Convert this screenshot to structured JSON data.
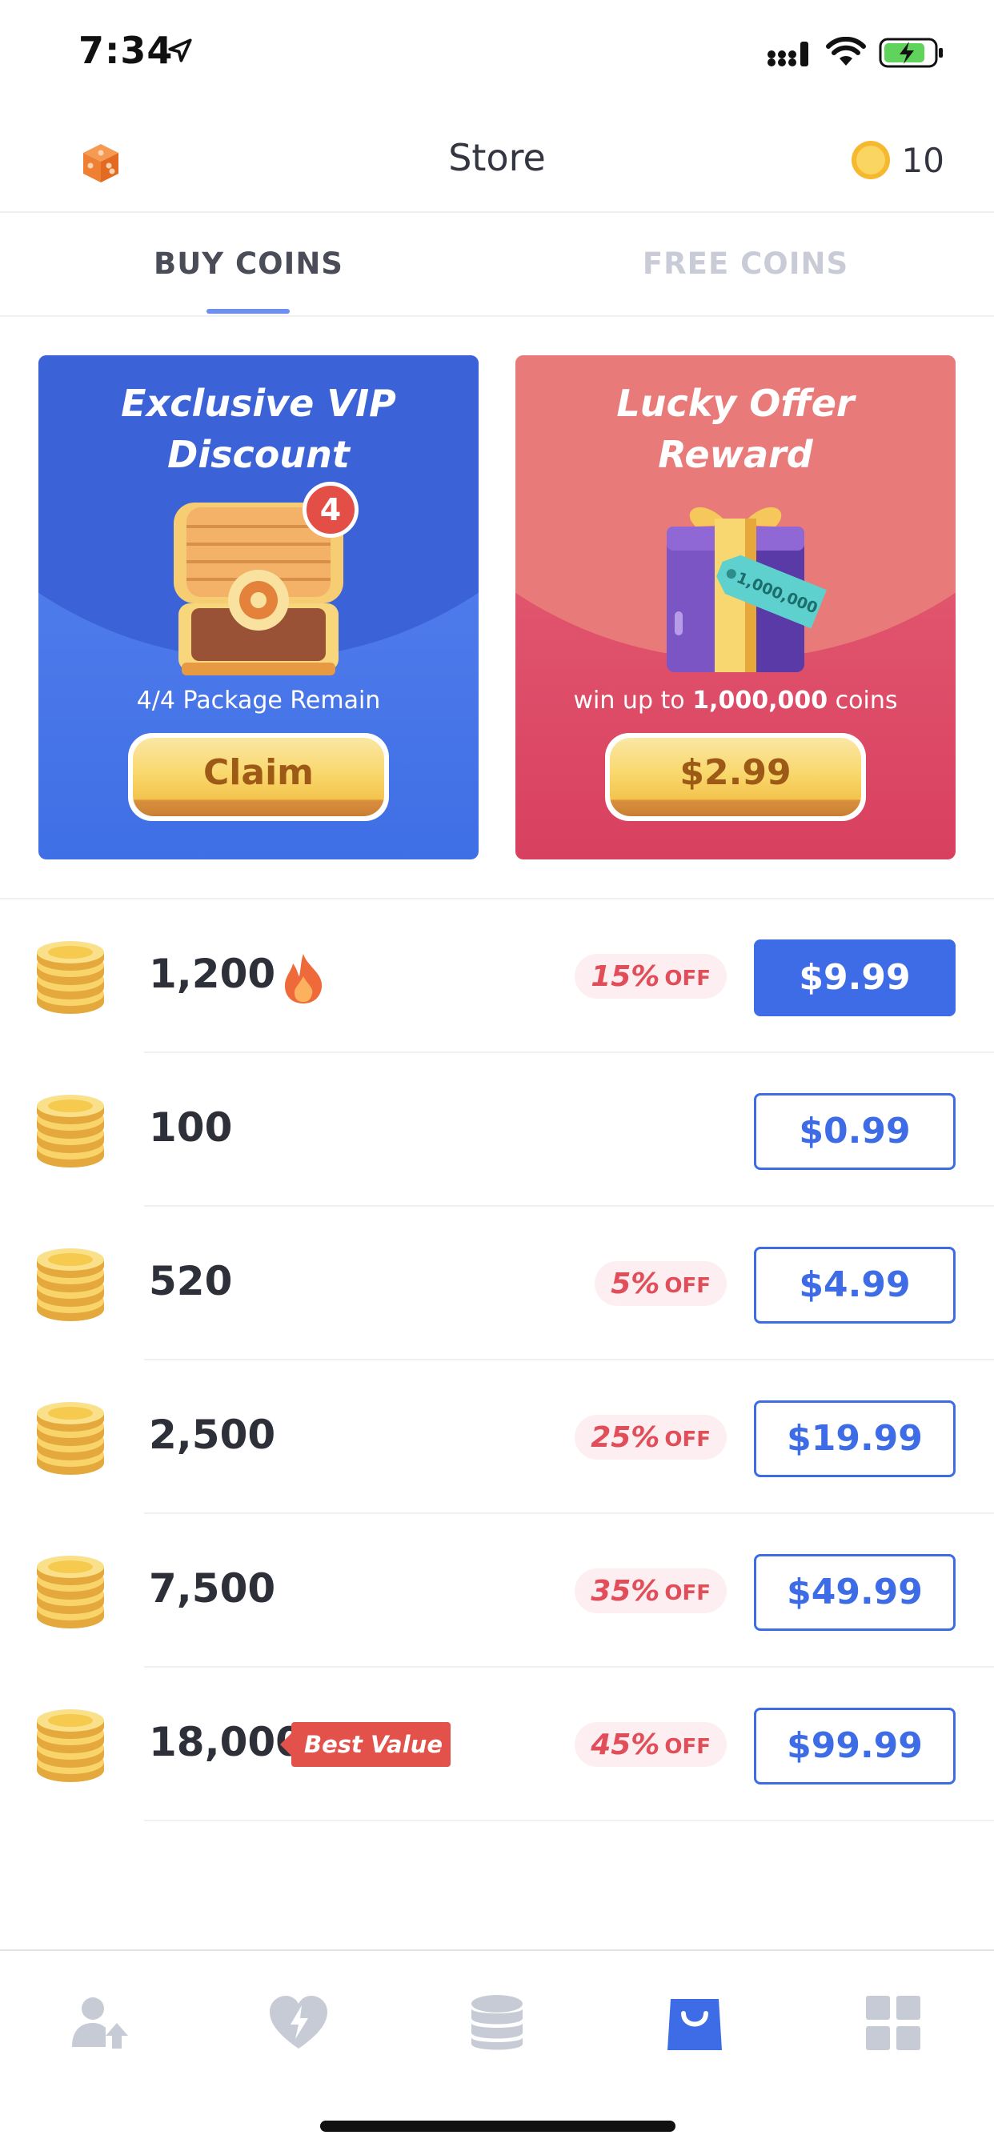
{
  "status_bar": {
    "time": "7:34"
  },
  "header": {
    "title": "Store",
    "coin_balance": "10"
  },
  "tabs": [
    {
      "label": "BUY COINS",
      "active": true
    },
    {
      "label": "FREE COINS",
      "active": false
    }
  ],
  "promos": {
    "vip": {
      "title_line1": "Exclusive VIP",
      "title_line2": "Discount",
      "badge": "4",
      "subtitle": "4/4 Package Remain",
      "button": "Claim"
    },
    "lucky": {
      "title_line1": "Lucky Offer",
      "title_line2": "Reward",
      "tag": "1,000,000",
      "subtitle_prefix": "win up to ",
      "subtitle_amount": "1,000,000",
      "subtitle_suffix": " coins",
      "button": "$2.99"
    }
  },
  "packages": [
    {
      "amount": "1,200",
      "discount_pct": "15%",
      "discount_off": "OFF",
      "price": "$9.99"
    },
    {
      "amount": "100",
      "price": "$0.99"
    },
    {
      "amount": "520",
      "discount_pct": "5%",
      "discount_off": "OFF",
      "price": "$4.99"
    },
    {
      "amount": "2,500",
      "discount_pct": "25%",
      "discount_off": "OFF",
      "price": "$19.99"
    },
    {
      "amount": "7,500",
      "discount_pct": "35%",
      "discount_off": "OFF",
      "price": "$49.99"
    },
    {
      "amount": "18,000",
      "badge": "Best Value",
      "discount_pct": "45%",
      "discount_off": "OFF",
      "price": "$99.99"
    }
  ],
  "tab_bar": [
    {
      "icon": "user-boost-icon",
      "active": false
    },
    {
      "icon": "heart-bolt-icon",
      "active": false
    },
    {
      "icon": "coins-stack-icon",
      "active": false
    },
    {
      "icon": "store-bag-icon",
      "active": true
    },
    {
      "icon": "grid-icon",
      "active": false
    }
  ],
  "colors": {
    "accent": "#3d6ce6",
    "vip_card": "#4a78ea",
    "lucky_card": "#e05a6c",
    "discount_text": "#e14e5a",
    "gold": "#f8d46a"
  }
}
